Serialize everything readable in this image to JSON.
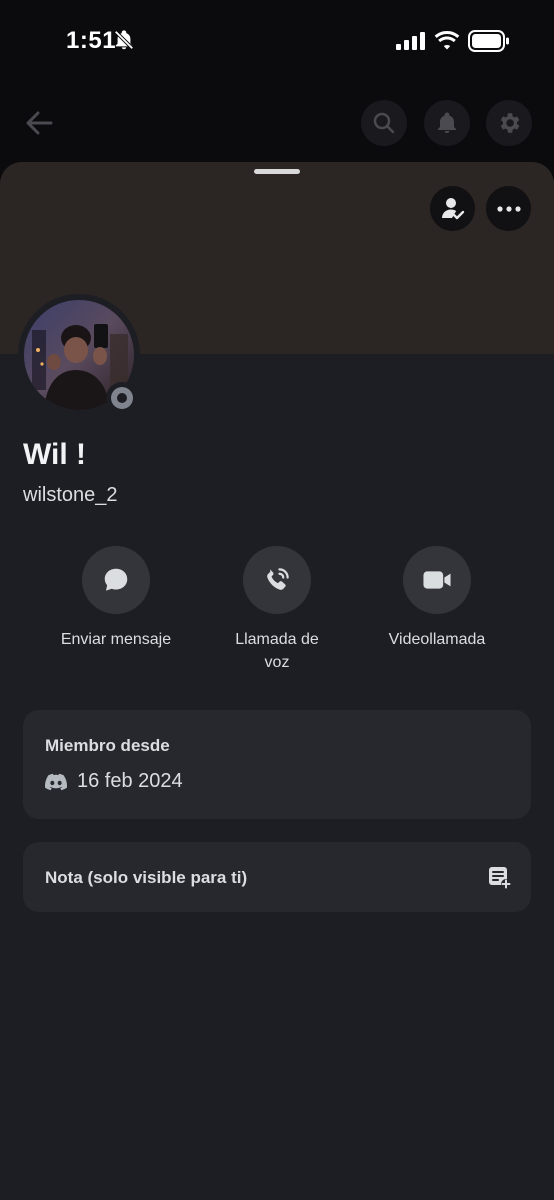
{
  "status_bar": {
    "time": "1:51",
    "icons": [
      "bell-slash-icon",
      "cellular-signal-icon",
      "wifi-icon",
      "battery-icon"
    ]
  },
  "top_nav": {
    "icons": [
      "back-arrow-icon",
      "search-icon",
      "bell-icon",
      "gear-icon"
    ]
  },
  "profile": {
    "display_name": "Wil !",
    "username": "wilstone_2",
    "status": "offline",
    "banner_color": "#2b2523",
    "header_buttons": [
      "friend-check-icon",
      "more-dots-icon"
    ]
  },
  "actions": [
    {
      "label": "Enviar mensaje",
      "icon": "chat-bubble-icon"
    },
    {
      "label": "Llamada de voz",
      "icon": "phone-call-icon"
    },
    {
      "label": "Videollamada",
      "icon": "video-camera-icon"
    }
  ],
  "member_since": {
    "title": "Miembro desde",
    "icon": "discord-logo-icon",
    "date": "16 feb 2024"
  },
  "note": {
    "title": "Nota (solo visible para ti)",
    "icon": "add-note-icon"
  },
  "colors": {
    "background": "#0b0a0c",
    "sheet": "#1d1e23",
    "card": "#27282e",
    "action_button": "#34353b",
    "status_offline": "#80848e"
  }
}
